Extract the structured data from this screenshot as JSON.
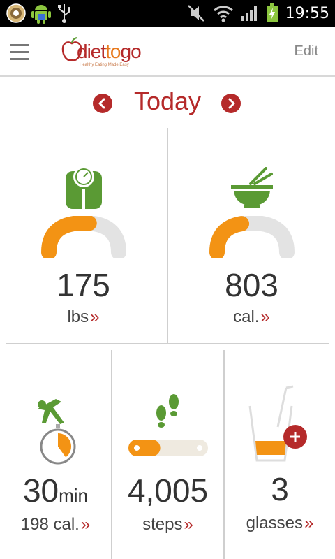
{
  "status_bar": {
    "time": "19:55",
    "icons": [
      "notification-app-icon",
      "android-icon",
      "usb-icon",
      "mute-icon",
      "wifi-icon",
      "signal-icon",
      "battery-charging-icon"
    ]
  },
  "app_bar": {
    "logo": {
      "brand_1": "diet",
      "brand_2": "to",
      "brand_3": "go",
      "tagline": "Healthy Eating Made Easy"
    },
    "edit_label": "Edit"
  },
  "date_nav": {
    "label": "Today",
    "prev_icon": "chevron-left-icon",
    "next_icon": "chevron-right-icon"
  },
  "colors": {
    "brand_red": "#b52a2a",
    "accent_orange": "#f39314",
    "icon_green": "#5a9a34",
    "gauge_bg": "#e3e3e3",
    "slider_bg": "#efeae0"
  },
  "tiles": {
    "weight": {
      "value": "175",
      "link": "lbs",
      "icon": "scale-icon",
      "progress": 0.55
    },
    "calories": {
      "value": "803",
      "link": "cal.",
      "icon": "bowl-icon",
      "progress": 0.4
    },
    "exercise": {
      "value": "30",
      "unit": "min",
      "link": "198 cal.",
      "icon": "exercise-timer-icon",
      "progress": 0.4
    },
    "steps": {
      "value": "4,005",
      "link": "steps",
      "icon": "footsteps-icon",
      "progress": 0.4
    },
    "water": {
      "value": "3",
      "link": "glasses",
      "icon": "water-glass-icon",
      "add_icon": "add-icon",
      "progress": 0.35
    }
  }
}
